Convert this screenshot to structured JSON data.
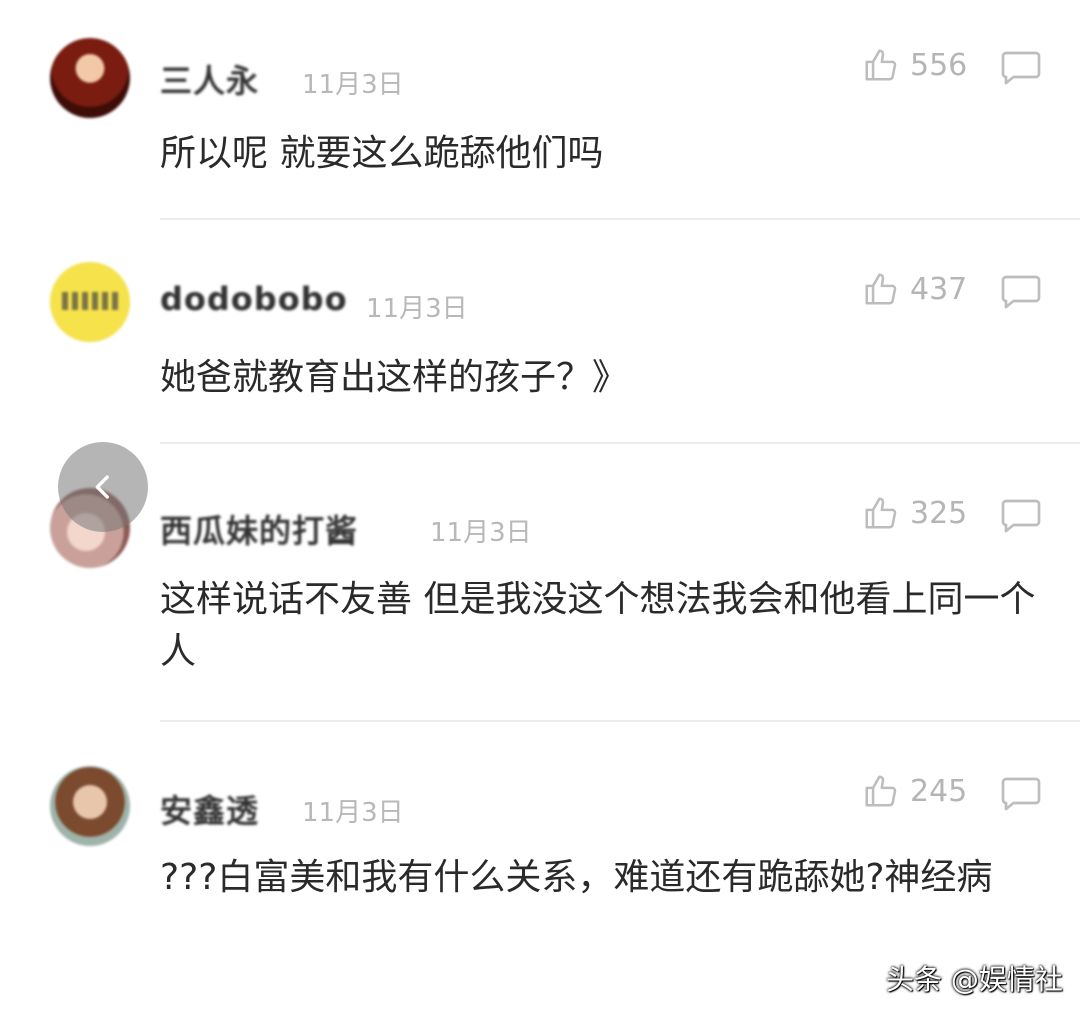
{
  "comments": [
    {
      "username": "三人永",
      "date": "11月3日",
      "likes": "556",
      "content": "所以呢  就要这么跪舔他们吗"
    },
    {
      "username": "dodobobo",
      "date": "11月3日",
      "likes": "437",
      "content": "她爸就教育出这样的孩子？》"
    },
    {
      "username": "西瓜妹的打酱",
      "date": "11月3日",
      "likes": "325",
      "content": "这样说话不友善 但是我没这个想法我会和他看上同一个人"
    },
    {
      "username": "安鑫透",
      "date": "11月3日",
      "likes": "245",
      "content": "???白富美和我有什么关系，难道还有跪舔她?神经病"
    }
  ],
  "watermark": "头条 @娱情社",
  "icons": {
    "like": "thumbs-up-icon",
    "reply": "comment-bubble-icon",
    "back": "chevron-left-icon"
  },
  "colors": {
    "meta_gray": "#b5b5b5",
    "divider": "#ececec",
    "text": "#2a2a2a"
  }
}
